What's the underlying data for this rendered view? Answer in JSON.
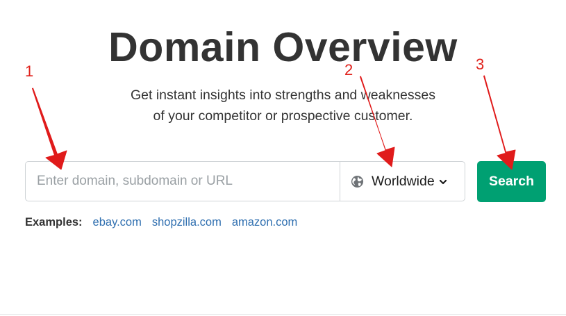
{
  "page": {
    "title": "Domain Overview",
    "subtitle_line1": "Get instant insights into strengths and weaknesses",
    "subtitle_line2": "of your competitor or prospective customer."
  },
  "search": {
    "placeholder": "Enter domain, subdomain or URL",
    "value": "",
    "database_label": "Worldwide",
    "button_label": "Search",
    "button_color": "#00a072"
  },
  "examples": {
    "label": "Examples:",
    "links": [
      "ebay.com",
      "shopzilla.com",
      "amazon.com"
    ]
  },
  "annotations": {
    "color": "#e0211b",
    "markers": [
      "1",
      "2",
      "3"
    ]
  }
}
